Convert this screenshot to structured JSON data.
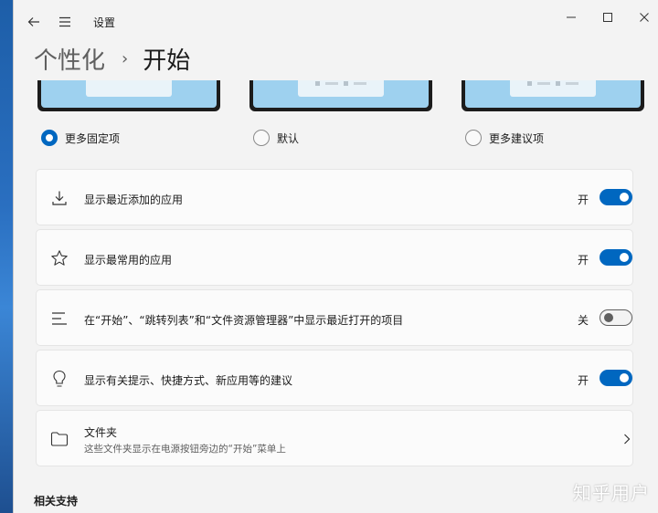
{
  "window": {
    "app_title": "设置"
  },
  "breadcrumb": {
    "parent": "个性化",
    "separator": "›",
    "current": "开始"
  },
  "layout_options": [
    {
      "label": "更多固定项",
      "selected": true
    },
    {
      "label": "默认",
      "selected": false
    },
    {
      "label": "更多建议项",
      "selected": false
    }
  ],
  "settings": [
    {
      "label": "显示最近添加的应用",
      "state_label": "开",
      "on": true,
      "icon": "download-icon"
    },
    {
      "label": "显示最常用的应用",
      "state_label": "开",
      "on": true,
      "icon": "star-icon"
    },
    {
      "label": "在“开始”、“跳转列表”和“文件资源管理器”中显示最近打开的项目",
      "state_label": "关",
      "on": false,
      "icon": "list-icon"
    },
    {
      "label": "显示有关提示、快捷方式、新应用等的建议",
      "state_label": "开",
      "on": true,
      "icon": "lightbulb-icon"
    }
  ],
  "folders": {
    "label": "文件夹",
    "description": "这些文件夹显示在电源按钮旁边的“开始”菜单上",
    "icon": "folder-icon"
  },
  "related_section": {
    "title": "相关支持"
  },
  "watermark": "知乎用户",
  "colors": {
    "accent": "#0067c0",
    "window_bg": "#f3f3f3",
    "card_bg": "#fbfbfb"
  }
}
